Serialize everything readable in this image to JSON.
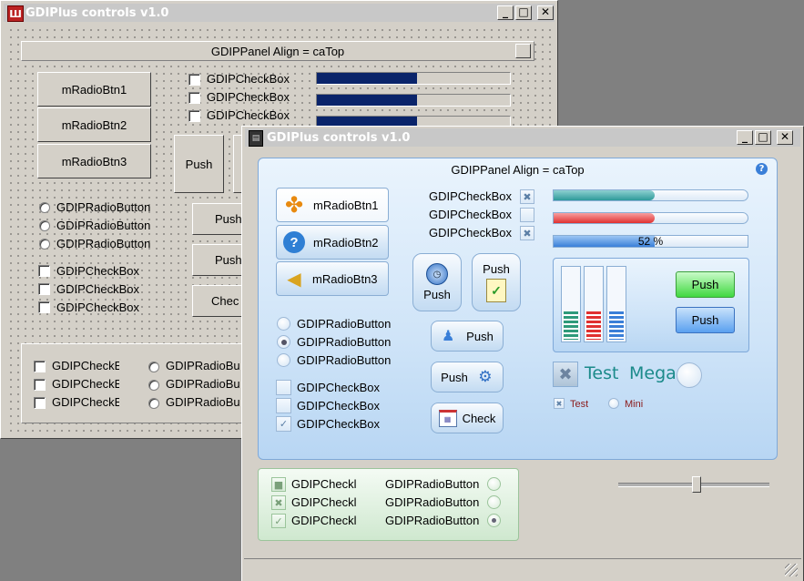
{
  "back_window": {
    "title": "GDIPlus controls v1.0",
    "caption_buttons": {
      "minimize": "_",
      "maximize": "□",
      "close": "✕"
    },
    "panel_title": "GDIPPanel Align = caTop",
    "radio_buttons": [
      "mRadioBtn1",
      "mRadioBtn2",
      "mRadioBtn3"
    ],
    "top_checkboxes": [
      "GDIPCheckBox",
      "GDIPCheckBox",
      "GDIPCheckBox"
    ],
    "progress": [
      0.52,
      0.52,
      0.52
    ],
    "push_big": "Push",
    "push_small": [
      "Push",
      "Push"
    ],
    "check_button": "Chec",
    "radios": [
      "GDIPRadioButton",
      "GDIPRadioButton",
      "GDIPRadioButton"
    ],
    "checkboxes": [
      "GDIPCheckBox",
      "GDIPCheckBox",
      "GDIPCheckBox"
    ],
    "bottom_checkboxes": [
      "GDIPCheckE",
      "GDIPCheckE",
      "GDIPCheckE"
    ],
    "bottom_radios": [
      "GDIPRadioBu",
      "GDIPRadioBu",
      "GDIPRadioBu"
    ]
  },
  "front_window": {
    "title": "GDIPlus controls v1.0",
    "caption_buttons": {
      "minimize": "_",
      "maximize": "□",
      "close": "✕"
    },
    "panel_title": "GDIPPanel Align = caTop",
    "help_icon": "?",
    "radio_buttons": [
      "mRadioBtn1",
      "mRadioBtn2",
      "mRadioBtn3"
    ],
    "checkboxes_right": [
      "GDIPCheckBox",
      "GDIPCheckBox",
      "GDIPCheckBox"
    ],
    "checkboxes_right_marks": [
      "✖",
      "",
      "✖"
    ],
    "progress": [
      {
        "value": 0.52,
        "color": "#2e9a9a"
      },
      {
        "value": 0.52,
        "color": "#e03030"
      },
      {
        "value": 0.52,
        "color": "#3a7fd8",
        "label": "52 %"
      }
    ],
    "push_clock": "Push",
    "push_doc": "Push",
    "push_small1": "Push",
    "push_small2": "Push",
    "check_button": "Check",
    "radios": [
      "GDIPRadioButton",
      "GDIPRadioButton",
      "GDIPRadioButton"
    ],
    "radios_selected": 1,
    "checkboxes": [
      "GDIPCheckBox",
      "GDIPCheckBox",
      "GDIPCheckBox"
    ],
    "checkboxes_marks": [
      "",
      "",
      "✓"
    ],
    "level_bars": [
      {
        "level": 0.4,
        "color": "#2e9a7a"
      },
      {
        "level": 0.4,
        "color": "#e03030"
      },
      {
        "level": 0.4,
        "color": "#3a7fd8"
      }
    ],
    "green_push": "Push",
    "blue_push": "Push",
    "test_label": "Test",
    "mega_label": "Mega",
    "mini_test": "Test",
    "mini_mini": "Mini",
    "green_panel": {
      "checkboxes": [
        "GDIPCheckl",
        "GDIPCheckl",
        "GDIPCheckl"
      ],
      "checkbox_marks": [
        "■",
        "✖",
        "✓"
      ],
      "radios": [
        "GDIPRadioButton",
        "GDIPRadioButton",
        "GDIPRadioButton"
      ],
      "radios_selected": 2
    },
    "slider_value": 0.52
  },
  "colors": {
    "desktop": "#808080",
    "face": "#d4d0c8",
    "progress_classic": "#0a246a",
    "teal_text": "#1b8a8a",
    "dark_red_text": "#8b1a1a"
  }
}
